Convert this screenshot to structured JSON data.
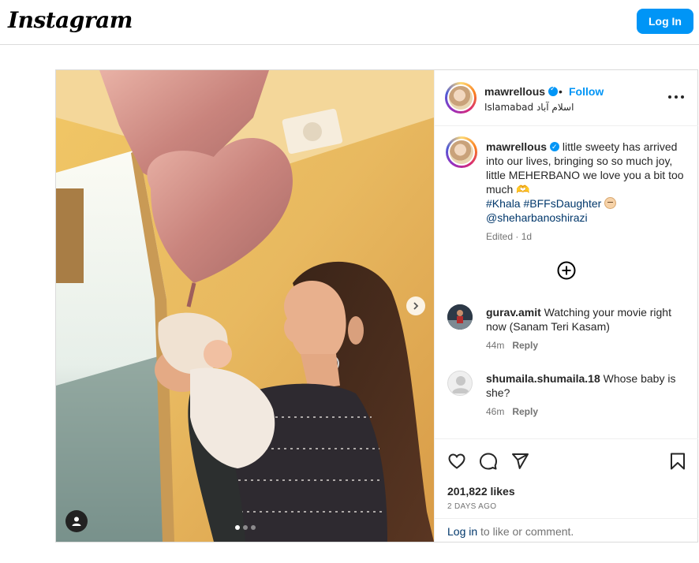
{
  "header": {
    "logo": "Instagram",
    "login_button": "Log In"
  },
  "post": {
    "author": {
      "username": "mawrellous",
      "separator": "•",
      "follow_label": "Follow",
      "location": "Islamabad اسلام آباد"
    },
    "caption": {
      "username": "mawrellous",
      "text": " little sweety has arrived into our lives, bringing so so much joy, little MEHERBANO we love you a bit too much 🫶",
      "hashtag_1": "#Khala",
      "hashtag_2": "#BFFsDaughter",
      "mention": "@sheharbanoshirazi",
      "meta": "Edited · 1d"
    },
    "comments": [
      {
        "username": "gurav.amit",
        "text": " Watching your movie right now (Sanam Teri Kasam)",
        "time": "44m",
        "reply_label": "Reply"
      },
      {
        "username": "shumaila.shumaila.18",
        "text": " Whose baby is she?",
        "time": "46m",
        "reply_label": "Reply"
      }
    ],
    "likes": "201,822 likes",
    "posted_ago": "2 DAYS AGO",
    "login_prompt": {
      "link": "Log in",
      "rest": " to like or comment."
    },
    "carousel": {
      "slide_count": 3,
      "active_slide": 1
    }
  },
  "icons": [
    "more-icon",
    "add-comment-icon",
    "heart-icon",
    "comment-icon",
    "share-icon",
    "bookmark-icon",
    "user-tag-icon",
    "next-arrow-icon",
    "verified-badge-icon"
  ],
  "colors": {
    "accent": "#0095f6",
    "link": "#00376b",
    "muted": "#737373",
    "text": "#262626",
    "border": "#dbdbdb"
  }
}
